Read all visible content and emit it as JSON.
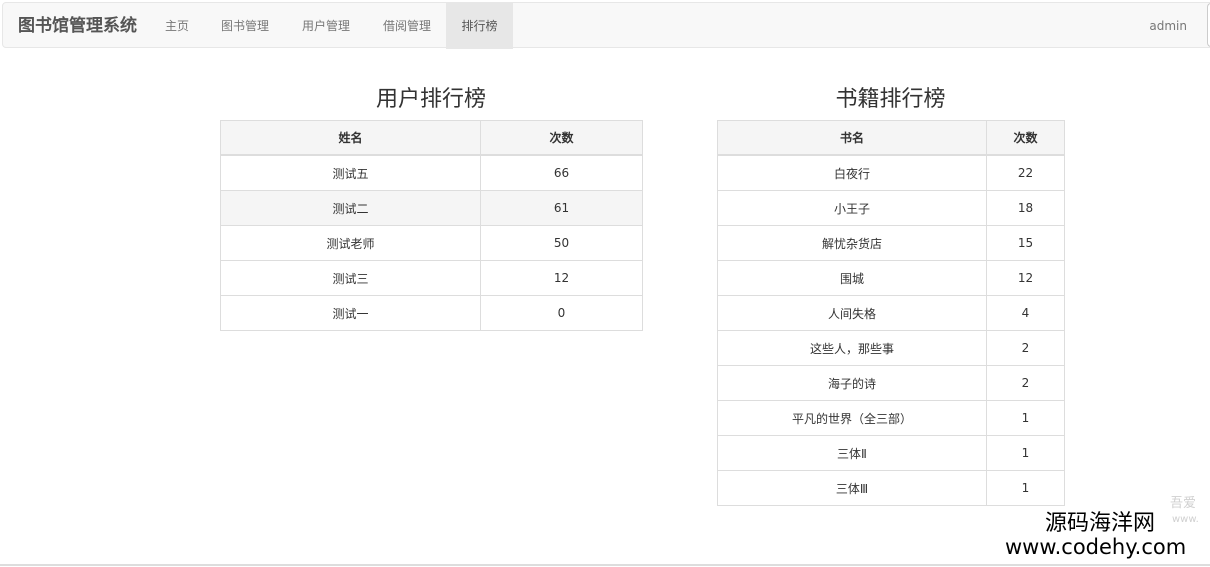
{
  "navbar": {
    "brand": "图书馆管理系统",
    "items": [
      {
        "label": "主页",
        "active": false
      },
      {
        "label": "图书管理",
        "active": false
      },
      {
        "label": "用户管理",
        "active": false
      },
      {
        "label": "借阅管理",
        "active": false
      },
      {
        "label": "排行榜",
        "active": true
      }
    ],
    "user": "admin"
  },
  "user_ranking": {
    "title": "用户排行榜",
    "columns": [
      "姓名",
      "次数"
    ],
    "rows": [
      {
        "name": "测试五",
        "count": "66"
      },
      {
        "name": "测试二",
        "count": "61"
      },
      {
        "name": "测试老师",
        "count": "50"
      },
      {
        "name": "测试三",
        "count": "12"
      },
      {
        "name": "测试一",
        "count": "0"
      }
    ]
  },
  "book_ranking": {
    "title": "书籍排行榜",
    "columns": [
      "书名",
      "次数"
    ],
    "rows": [
      {
        "name": "白夜行",
        "count": "22"
      },
      {
        "name": "小王子",
        "count": "18"
      },
      {
        "name": "解忧杂货店",
        "count": "15"
      },
      {
        "name": "围城",
        "count": "12"
      },
      {
        "name": "人间失格",
        "count": "4"
      },
      {
        "name": "这些人，那些事",
        "count": "2"
      },
      {
        "name": "海子的诗",
        "count": "2"
      },
      {
        "name": "平凡的世界（全三部）",
        "count": "1"
      },
      {
        "name": "三体Ⅱ",
        "count": "1"
      },
      {
        "name": "三体Ⅲ",
        "count": "1"
      }
    ]
  },
  "watermark": {
    "line1": "源码海洋网",
    "line2": "www.codehy.com",
    "faint1": "吾爱",
    "faint2": "www."
  }
}
